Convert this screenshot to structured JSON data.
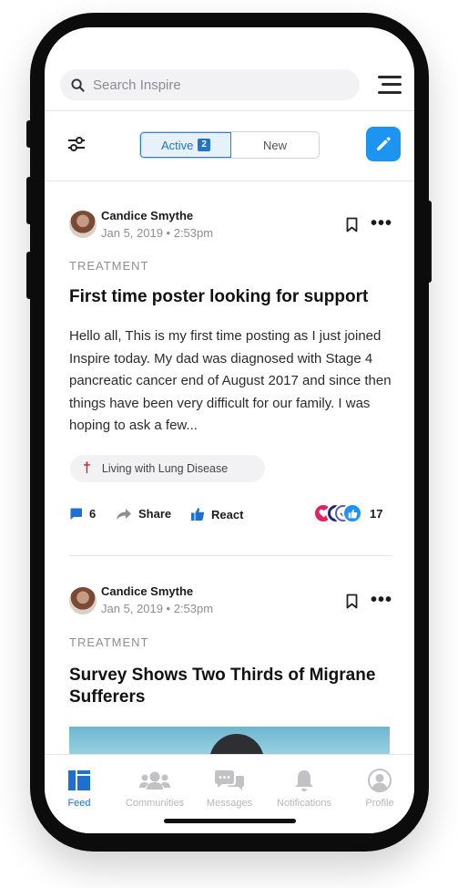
{
  "search": {
    "placeholder": "Search Inspire"
  },
  "filter": {
    "active_label": "Active",
    "active_count": "2",
    "new_label": "New"
  },
  "posts": [
    {
      "author": "Candice Smythe",
      "date": "Jan 5, 2019 • 2:53pm",
      "category": "TREATMENT",
      "title": "First time poster looking for support",
      "body": "Hello all, This is my first time posting as I just joined Inspire today. My dad was diagnosed with Stage 4 pancreatic cancer end of August 2017 and since then things have been very difficult for our family. I was hoping to ask a few...",
      "tag": "Living with Lung Disease",
      "comments": "6",
      "share_label": "Share",
      "react_label": "React",
      "reaction_count": "17"
    },
    {
      "author": "Candice Smythe",
      "date": "Jan 5, 2019 • 2:53pm",
      "category": "TREATMENT",
      "title": "Survey Shows Two Thirds of Migrane Sufferers"
    }
  ],
  "tabs": [
    {
      "label": "Feed",
      "icon": "feed-icon"
    },
    {
      "label": "Communities",
      "icon": "communities-icon"
    },
    {
      "label": "Messages",
      "icon": "messages-icon"
    },
    {
      "label": "Notifications",
      "icon": "bell-icon"
    },
    {
      "label": "Profile",
      "icon": "profile-icon"
    }
  ],
  "colors": {
    "accent": "#1d94f2",
    "active_tab": "#1d6fd1",
    "tag_icon": "#d11f24",
    "reaction_love": "#e0245e",
    "reaction_like": "#1d94f2"
  }
}
